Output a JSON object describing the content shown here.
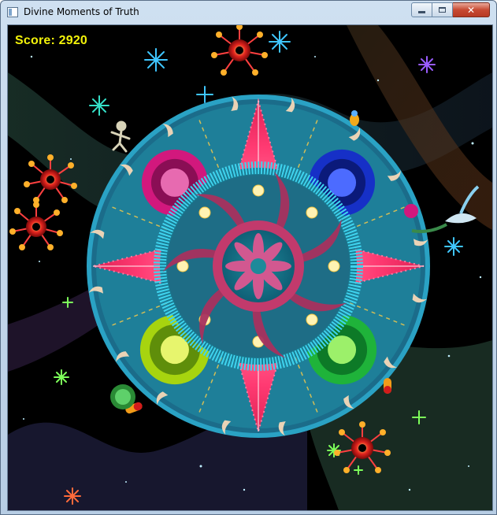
{
  "window": {
    "title": "Divine Moments of Truth",
    "controls": {
      "close_glyph": "✕"
    }
  },
  "hud": {
    "score_label": "Score: 2920"
  },
  "colors": {
    "score": "#f2f20a",
    "background": "#000000",
    "ring_outer": "#2aa2c4",
    "star_point": "#f0205a",
    "inner_ring": "#3fd3ee",
    "center_flower": "#a8325e"
  },
  "icons": [
    "app-icon",
    "minimize-icon",
    "maximize-icon",
    "close-icon"
  ]
}
